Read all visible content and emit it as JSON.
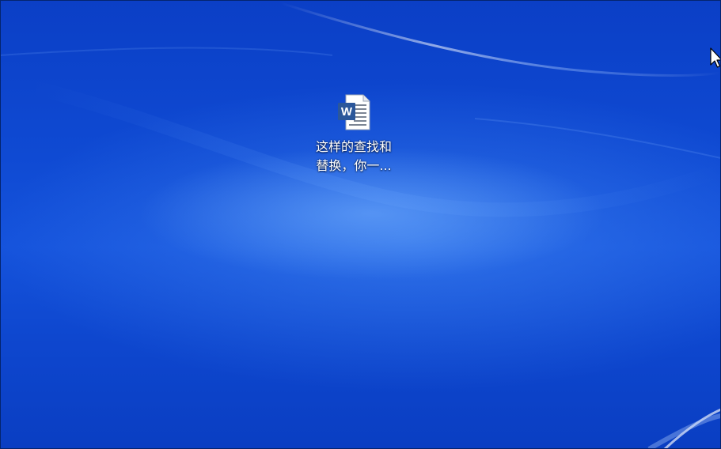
{
  "desktop": {
    "background_color": "#0a3fc4",
    "icons": [
      {
        "icon": "word-document-icon",
        "label": "这样的查找和\n替换，你一...",
        "badge_letter": "W",
        "accent_color": "#2b579a"
      }
    ]
  },
  "cursor": {
    "icon": "mouse-pointer-icon"
  }
}
